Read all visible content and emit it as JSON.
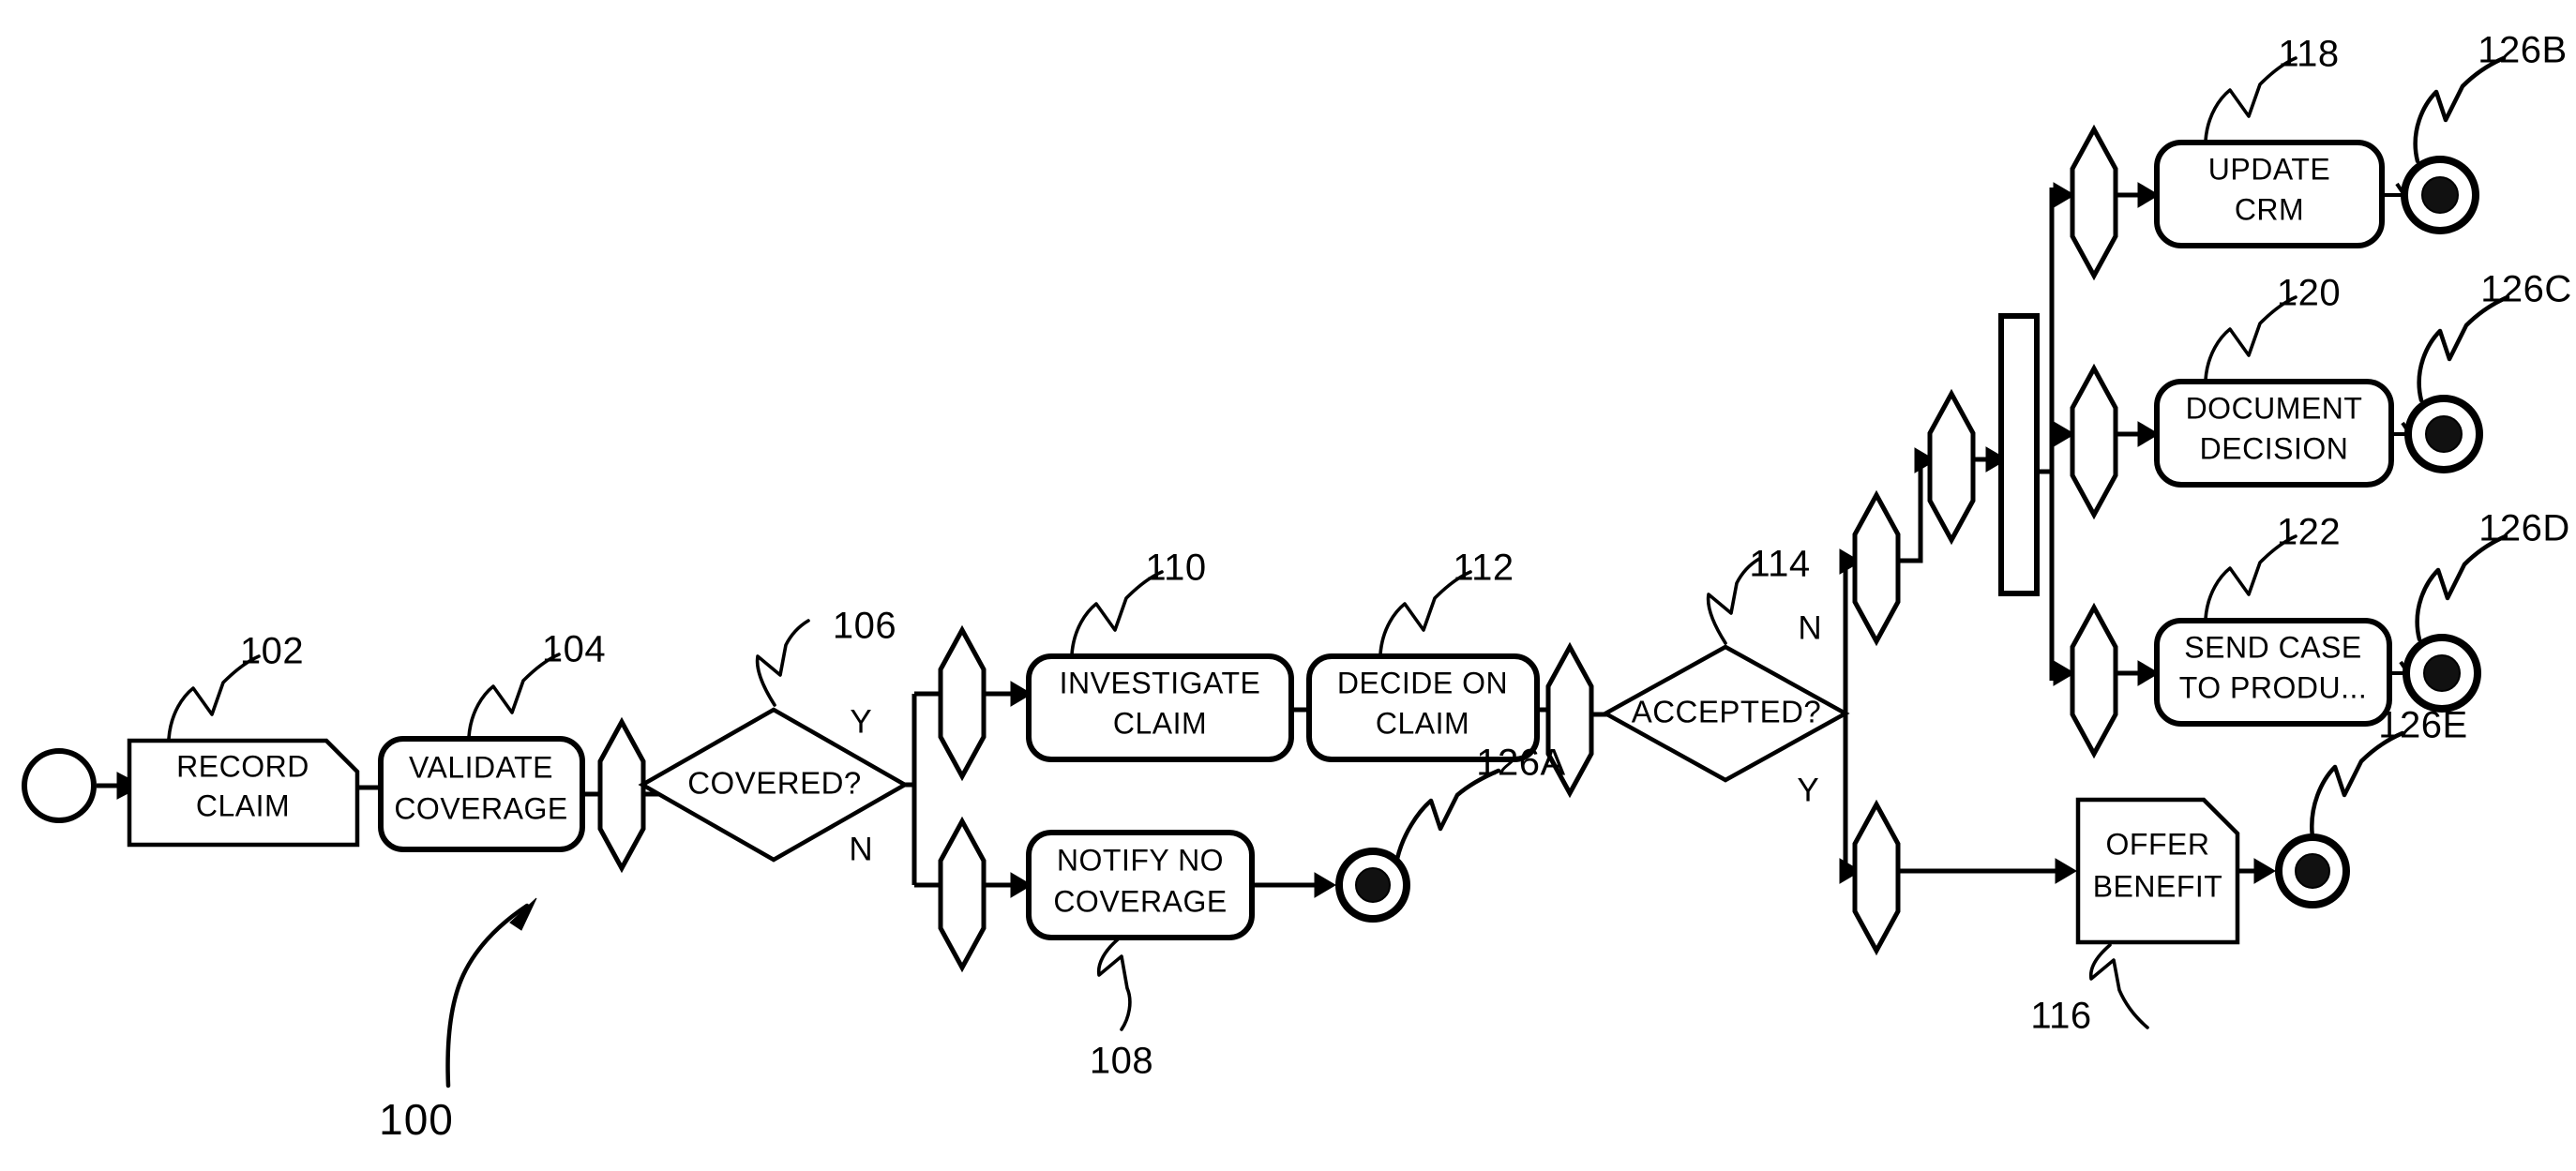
{
  "figure": {
    "ref": "100",
    "kind": "patent-flowchart",
    "title": "Claim handling process flow"
  },
  "start_event": {
    "name": "start"
  },
  "tasks": [
    {
      "id": "record-claim",
      "label_lines": [
        "RECORD",
        "CLAIM"
      ],
      "ref": "102",
      "shape": "clipped-rect"
    },
    {
      "id": "validate-coverage",
      "label_lines": [
        "VALIDATE",
        "COVERAGE"
      ],
      "ref": "104",
      "shape": "rounded-rect"
    },
    {
      "id": "investigate-claim",
      "label_lines": [
        "INVESTIGATE",
        "CLAIM"
      ],
      "ref": "110",
      "shape": "rounded-rect"
    },
    {
      "id": "decide-on-claim",
      "label_lines": [
        "DECIDE ON",
        "CLAIM"
      ],
      "ref": "112",
      "shape": "rounded-rect"
    },
    {
      "id": "notify-no-coverage",
      "label_lines": [
        "NOTIFY NO",
        "COVERAGE"
      ],
      "ref": "108",
      "shape": "rounded-rect"
    },
    {
      "id": "update-crm",
      "label_lines": [
        "UPDATE",
        "CRM"
      ],
      "ref": "118",
      "shape": "rounded-rect"
    },
    {
      "id": "document-decision",
      "label_lines": [
        "DOCUMENT",
        "DECISION"
      ],
      "ref": "120",
      "shape": "rounded-rect"
    },
    {
      "id": "send-case",
      "label_lines": [
        "SEND CASE",
        "TO PRODU..."
      ],
      "ref": "122",
      "shape": "rounded-rect"
    },
    {
      "id": "offer-benefit",
      "label_lines": [
        "OFFER",
        "BENEFIT"
      ],
      "ref": "116",
      "shape": "clipped-rect"
    }
  ],
  "decisions": [
    {
      "id": "covered",
      "label": "COVERED?",
      "ref": "106",
      "yes": "Y",
      "no": "N"
    },
    {
      "id": "accepted",
      "label": "ACCEPTED?",
      "ref": "114",
      "yes": "Y",
      "no": "N"
    }
  ],
  "end_events": [
    {
      "id": "end-a",
      "ref": "126A"
    },
    {
      "id": "end-b",
      "ref": "126B"
    },
    {
      "id": "end-c",
      "ref": "126C"
    },
    {
      "id": "end-d",
      "ref": "126D"
    },
    {
      "id": "end-e",
      "ref": "126E"
    }
  ],
  "reference_numerals": {
    "figure": "100",
    "record_claim": "102",
    "validate_coverage": "104",
    "covered_decision": "106",
    "notify_no_coverage": "108",
    "investigate_claim": "110",
    "decide_on_claim": "112",
    "accepted_decision": "114",
    "offer_benefit": "116",
    "update_crm": "118",
    "document_decision": "120",
    "send_case_to_product": "122",
    "end_a": "126A",
    "end_b": "126B",
    "end_c": "126C",
    "end_d": "126D",
    "end_e": "126E"
  },
  "branch_labels": {
    "covered_yes": "Y",
    "covered_no": "N",
    "accepted_no": "N",
    "accepted_yes": "Y"
  },
  "colors": {
    "line": "#000000",
    "fill": "#ffffff",
    "end_inner": "#111111"
  }
}
